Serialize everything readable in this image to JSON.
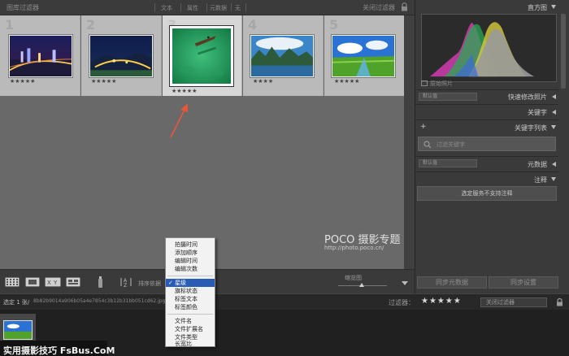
{
  "colors": {
    "grid_bg": "#696969",
    "panel_bg": "#3a3a3a",
    "menu_highlight": "#2a5cb5",
    "arrow": "#e8563a"
  },
  "filter_bar": {
    "title": "图库过滤器",
    "options": [
      "文本",
      "属性",
      "元数据",
      "无"
    ],
    "preset": "关闭过滤器",
    "lock_icon": "lock-icon"
  },
  "grid": {
    "cells": [
      {
        "number": "1",
        "stars": "★★★★★",
        "selected": false
      },
      {
        "number": "2",
        "stars": "★★★★★",
        "selected": false
      },
      {
        "number": "3",
        "stars": "★★★★★",
        "selected": true
      },
      {
        "number": "4",
        "stars": "★★★★",
        "selected": false
      },
      {
        "number": "5",
        "stars": "★★★★★",
        "selected": false
      }
    ],
    "watermark": "POCO 摄影专题",
    "watermark_url": "http://photo.poco.cn/"
  },
  "toolbar": {
    "sort_label": "排序依据",
    "thumb_size_label": "缩览图"
  },
  "sort_menu": {
    "groups": [
      [
        "拍摄时间",
        "添加顺序",
        "编辑时间",
        "编辑次数"
      ],
      [
        "星级",
        "旗标状态",
        "标签文本",
        "标签颜色"
      ],
      [
        "文件名",
        "文件扩展名",
        "文件类型",
        "长宽比"
      ]
    ],
    "selected": "星级"
  },
  "right_panel": {
    "histogram": "直方图",
    "original_photo": "原始照片",
    "quick_develop": "快速修改照片",
    "quick_develop_select": "默认值",
    "keywording": "关键字",
    "keyword_list": "关键字列表",
    "keyword_search_placeholder": "过滤关键字",
    "metadata": "元数据",
    "metadata_select": "默认值",
    "comments": "注释",
    "comments_note": "选定服务不支持注释",
    "sync_metadata": "同步元数据",
    "sync_settings": "同步设置"
  },
  "film_bar": {
    "selected": "选定 1 张/",
    "filename": "8b82b9014a906b05a4e7854c3b12b31bb051cd62.jpg",
    "filter_label": "过滤器：",
    "stars": "★★★★★",
    "filter_preset": "关闭过滤器"
  },
  "brand": {
    "text": "实用摄影技巧 FsBus.CoM"
  }
}
